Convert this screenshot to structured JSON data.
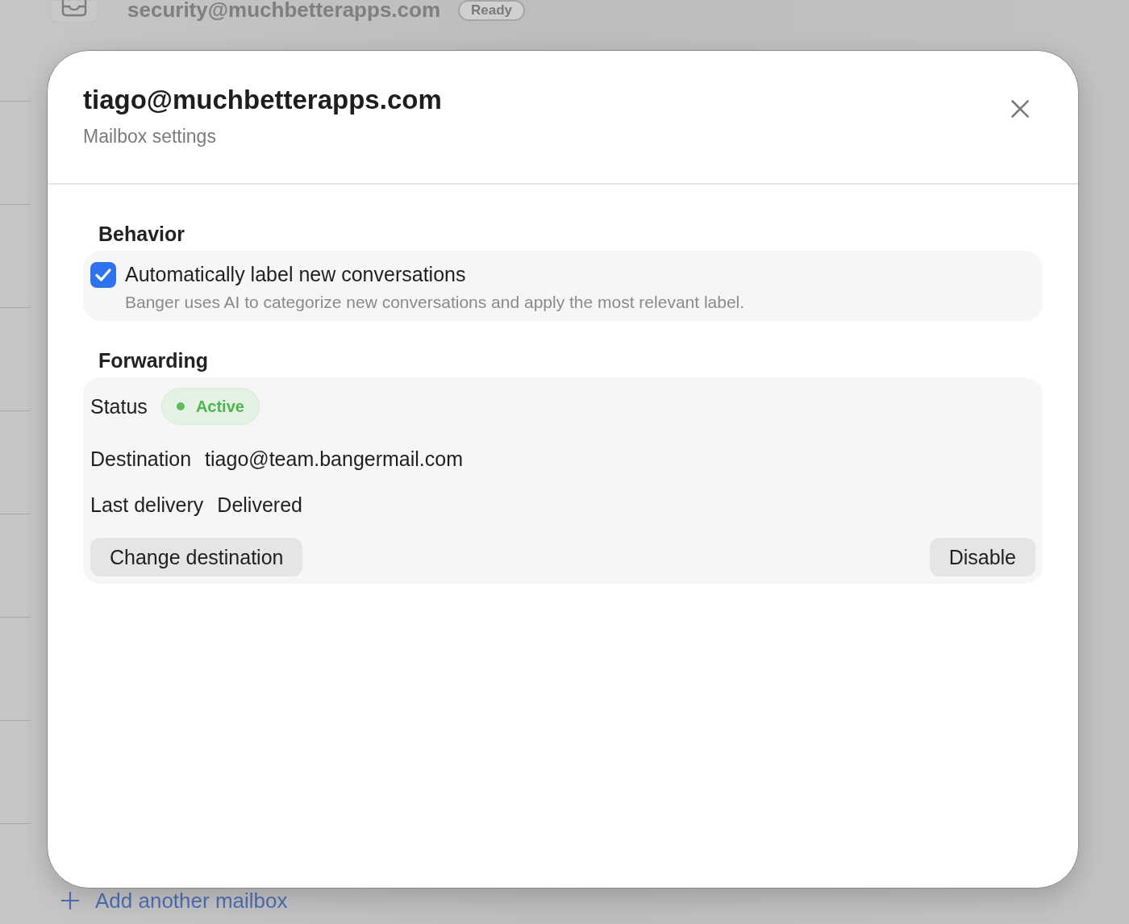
{
  "background": {
    "mailbox_row": {
      "address": "security@muchbetterapps.com",
      "status": "Ready"
    },
    "add_mailbox": {
      "label": "Add another mailbox"
    }
  },
  "dialog": {
    "title": "tiago@muchbetterapps.com",
    "subtitle": "Mailbox settings",
    "sections": [
      {
        "kind": "options",
        "heading": "Behavior",
        "options": [
          {
            "label": "Automatically label new conversations",
            "description": "Banger uses AI to categorize new conversations and apply the most relevant label.",
            "checked": true
          }
        ]
      },
      {
        "kind": "details",
        "heading": "Forwarding",
        "rows": [
          {
            "kind": "badge",
            "label": "Status",
            "value": "Active"
          },
          {
            "kind": "text",
            "label": "Destination",
            "value": "tiago@team.bangermail.com"
          },
          {
            "kind": "text",
            "label": "Last delivery",
            "value": "Delivered"
          }
        ],
        "buttons": [
          {
            "label": "Change destination"
          },
          {
            "label": "Disable"
          }
        ]
      }
    ]
  }
}
